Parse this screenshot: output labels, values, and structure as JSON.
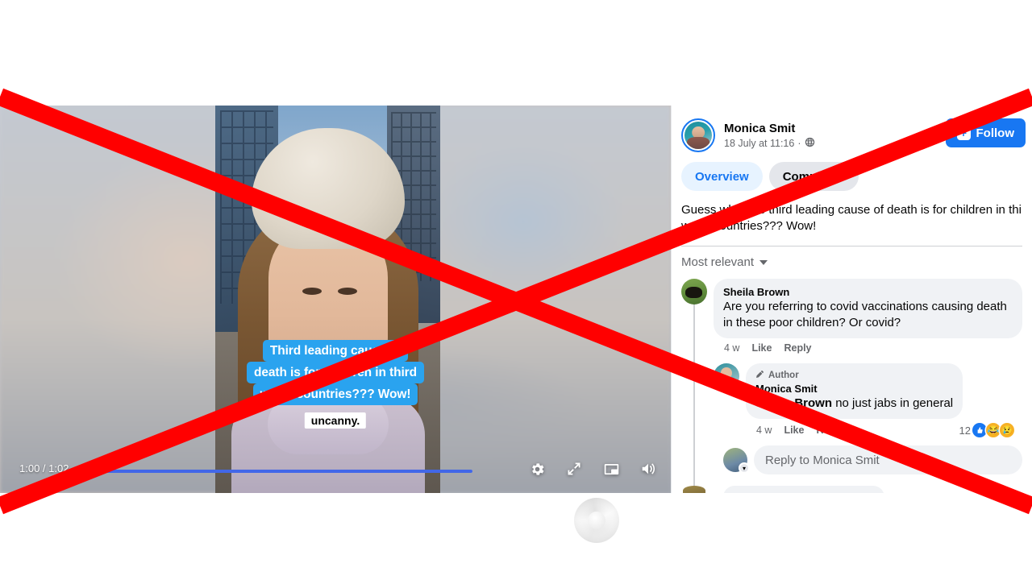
{
  "video": {
    "caption_lines": [
      "Third leading cause of",
      "death is for children in third",
      "world countries??? Wow!"
    ],
    "subtitle": "uncanny.",
    "player": {
      "time_label": "1:00 / 1:02",
      "settings_icon": "gear-icon",
      "fullscreen_icon": "expand-icon",
      "pip_icon": "picture-in-picture-icon",
      "volume_icon": "volume-on-icon",
      "progress_percent": 100
    }
  },
  "post": {
    "author_name": "Monica Smit",
    "timestamp": "18 July at 11:16",
    "privacy_icon": "globe-icon",
    "follow_label": "Follow",
    "follow_plus": "+",
    "tabs": [
      {
        "label": "Overview",
        "active": true
      },
      {
        "label": "Comments",
        "active": false
      }
    ],
    "body_line1": "Guess what the third leading cause of death is for children in thi",
    "body_line2": "world countries??? Wow!",
    "sort_label": "Most relevant"
  },
  "comments": [
    {
      "name": "Sheila Brown",
      "text": "Are you referring to covid vaccinations causing death in these poor children? Or covid?",
      "time": "4 w",
      "like_label": "Like",
      "reply_label": "Reply",
      "avatar": "sheep-avatar"
    }
  ],
  "reply": {
    "author_badge": "Author",
    "author_badge_icon": "pen-icon",
    "name": "Monica Smit",
    "mention": "Sheila Brown",
    "text": " no just jabs in general",
    "time": "4 w",
    "like_label": "Like",
    "reply_label": "Reply",
    "reaction_count": "12",
    "reactions": [
      "like-reaction",
      "haha-reaction",
      "sad-reaction"
    ]
  },
  "reply_input": {
    "placeholder": "Reply to Monica Smit"
  },
  "colors": {
    "brand_blue": "#1877f2",
    "caption_blue": "#2aa3ef",
    "overlay_red": "#ff0000",
    "bubble_grey": "#f0f2f5"
  }
}
